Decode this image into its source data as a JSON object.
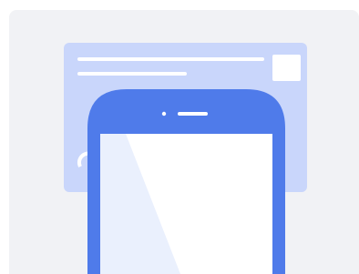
{
  "illustration": {
    "name": "desktop-to-mobile-illustration",
    "icons": [
      "browser-window-icon",
      "smartphone-icon"
    ],
    "colors": {
      "card_background": "#f1f2f5",
      "browser_fill": "#c9d6fb",
      "browser_lines": "#ffffff",
      "phone_body": "#4f7bea",
      "phone_screen": "#ffffff",
      "phone_screen_glare": "#eaf0fd",
      "phone_speaker": "#ffffff"
    }
  }
}
